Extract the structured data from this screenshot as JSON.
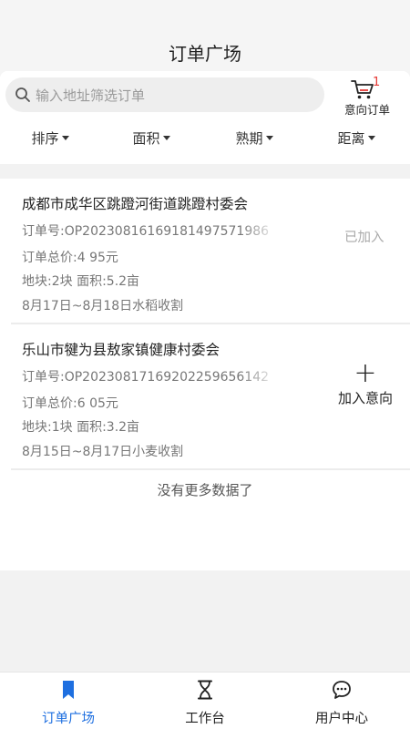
{
  "header": {
    "title": "订单广场"
  },
  "search": {
    "placeholder": "输入地址筛选订单"
  },
  "cart": {
    "badge": "1",
    "label": "意向订单"
  },
  "filters": [
    "排序",
    "面积",
    "熟期",
    "距离"
  ],
  "orders": [
    {
      "name": "成都市成华区跳蹬河街道跳蹬村委会",
      "order_no": "订单号:OP20230816169181497571986",
      "total": "订单总价:4 95元",
      "plot": "地块:2块 面积:5.2亩",
      "season": "8月17日~8月18日水稻收割",
      "status": "已加入"
    },
    {
      "name": "乐山市犍为县敖家镇健康村委会",
      "order_no": "订单号:OP20230817169202259656142",
      "total": "订单总价:6 05元",
      "plot": "地块:1块 面积:3.2亩",
      "season": "8月15日~8月17日小麦收割",
      "action_label": "加入意向"
    }
  ],
  "no_more": "没有更多数据了",
  "tabbar": [
    {
      "label": "订单广场",
      "icon": "bookmark-icon",
      "active": true
    },
    {
      "label": "工作台",
      "icon": "hourglass-icon",
      "active": false
    },
    {
      "label": "用户中心",
      "icon": "chat-bubble-icon",
      "active": false
    }
  ],
  "colors": {
    "accent": "#1e6fe0",
    "badge": "#e53935"
  }
}
